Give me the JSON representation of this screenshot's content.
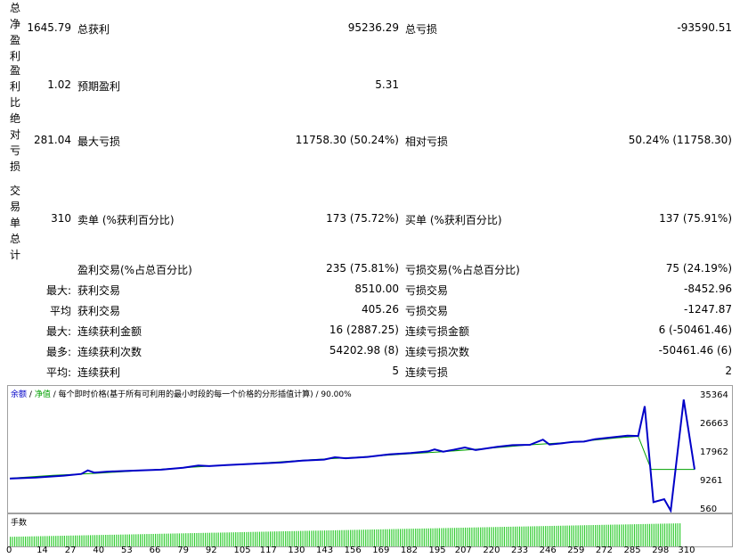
{
  "top_rows": [
    {
      "vlabel": "总净盈利",
      "v1": "1645.79",
      "l2": "总获利",
      "v2": "95236.29",
      "l3": "总亏损",
      "v3": "-93590.51"
    },
    {
      "vlabel": "盈利比",
      "v1": "1.02",
      "l2": "预期盈利",
      "v2": "5.31",
      "l3": "",
      "v3": ""
    },
    {
      "vlabel": "绝对亏损",
      "v1": "281.04",
      "l2": "最大亏损",
      "v2": "11758.30 (50.24%)",
      "l3": "相对亏损",
      "v3": "50.24% (11758.30)"
    },
    {
      "vlabel": "交易单总计",
      "v1": "310",
      "l2": "卖单 (%获利百分比)",
      "v2": "173 (75.72%)",
      "l3": "买单 (%获利百分比)",
      "v3": "137 (75.91%)"
    }
  ],
  "bottom_rows": [
    {
      "p": "",
      "l2": "盈利交易(%占总百分比)",
      "v2": "235 (75.81%)",
      "l3": "亏损交易(%占总百分比)",
      "v3": "75 (24.19%)"
    },
    {
      "p": "最大:",
      "l2": "获利交易",
      "v2": "8510.00",
      "l3": "亏损交易",
      "v3": "-8452.96"
    },
    {
      "p": "平均",
      "l2": "获利交易",
      "v2": "405.26",
      "l3": "亏损交易",
      "v3": "-1247.87"
    },
    {
      "p": "最大:",
      "l2": "连续获利金额",
      "v2": "16 (2887.25)",
      "l3": "连续亏损金额",
      "v3": "6 (-50461.46)"
    },
    {
      "p": "最多:",
      "l2": "连续获利次数",
      "v2": "54202.98 (8)",
      "l3": "连续亏损次数",
      "v3": "-50461.46 (6)"
    },
    {
      "p": "平均:",
      "l2": "连续获利",
      "v2": "5",
      "l3": "连续亏损",
      "v3": "2"
    }
  ],
  "chart": {
    "legend_balance": "余额",
    "legend_sep": "/",
    "legend_equity": "净值",
    "legend_desc": "/ 每个即时价格(基于所有可利用的最小时段的每一个价格的分形插值计算) / 90.00%",
    "volume_label": "手数",
    "colors": {
      "balance": "#0000c8",
      "equity": "#00a000",
      "volume": "#33cc33"
    }
  },
  "chart_data": {
    "type": "line",
    "xlim": [
      0,
      316
    ],
    "ylim": [
      560,
      36500
    ],
    "x_ticks": [
      "0",
      "14",
      "27",
      "40",
      "53",
      "66",
      "79",
      "92",
      "105",
      "117",
      "130",
      "143",
      "156",
      "169",
      "182",
      "195",
      "207",
      "220",
      "233",
      "246",
      "259",
      "272",
      "285",
      "298",
      "310"
    ],
    "y_ticks": [
      "35364",
      "26663",
      "17962",
      "9261",
      "560"
    ],
    "series": [
      {
        "name": "余额",
        "points": [
          [
            0,
            10500
          ],
          [
            20,
            11400
          ],
          [
            40,
            12000
          ],
          [
            60,
            12800
          ],
          [
            80,
            13700
          ],
          [
            100,
            14500
          ],
          [
            120,
            15300
          ],
          [
            140,
            16200
          ],
          [
            160,
            16900
          ],
          [
            180,
            17800
          ],
          [
            200,
            18600
          ],
          [
            220,
            19600
          ],
          [
            240,
            20700
          ],
          [
            260,
            21500
          ],
          [
            280,
            22800
          ],
          [
            290,
            23300
          ],
          [
            296,
            13200
          ],
          [
            300,
            13200
          ],
          [
            305,
            13200
          ],
          [
            310,
            13200
          ],
          [
            316,
            13200
          ]
        ]
      },
      {
        "name": "净值",
        "points": [
          [
            0,
            10400
          ],
          [
            12,
            10700
          ],
          [
            25,
            11300
          ],
          [
            33,
            11800
          ],
          [
            36,
            12900
          ],
          [
            39,
            12200
          ],
          [
            45,
            12500
          ],
          [
            60,
            12900
          ],
          [
            70,
            13100
          ],
          [
            80,
            13700
          ],
          [
            87,
            14400
          ],
          [
            92,
            14200
          ],
          [
            100,
            14500
          ],
          [
            115,
            15000
          ],
          [
            125,
            15300
          ],
          [
            135,
            15900
          ],
          [
            145,
            16200
          ],
          [
            150,
            16900
          ],
          [
            155,
            16600
          ],
          [
            165,
            17000
          ],
          [
            175,
            17800
          ],
          [
            185,
            18200
          ],
          [
            193,
            18700
          ],
          [
            196,
            19300
          ],
          [
            200,
            18600
          ],
          [
            205,
            19200
          ],
          [
            210,
            19900
          ],
          [
            215,
            19100
          ],
          [
            225,
            20100
          ],
          [
            232,
            20600
          ],
          [
            240,
            20700
          ],
          [
            246,
            22300
          ],
          [
            249,
            20800
          ],
          [
            255,
            21200
          ],
          [
            260,
            21600
          ],
          [
            265,
            21700
          ],
          [
            270,
            22400
          ],
          [
            277,
            22900
          ],
          [
            285,
            23500
          ],
          [
            290,
            23400
          ],
          [
            293,
            32500
          ],
          [
            297,
            3200
          ],
          [
            302,
            4100
          ],
          [
            305,
            600
          ],
          [
            311,
            34500
          ],
          [
            316,
            13200
          ]
        ]
      }
    ],
    "volume": {
      "bars": 310,
      "start": 0.3,
      "end": 0.72
    }
  }
}
